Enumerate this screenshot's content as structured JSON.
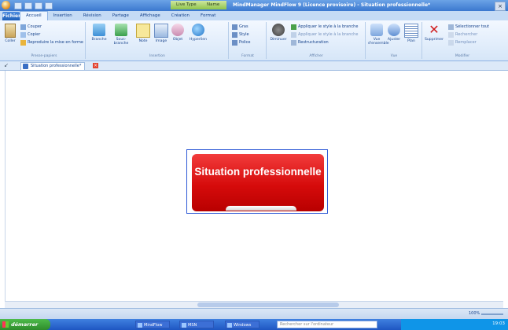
{
  "window": {
    "title": "MindManager MindFlow 9 (Licence provisoire) - Situation professionnelle*",
    "contextual_tabs": [
      "Live Type",
      "Name"
    ],
    "close_symbol": "×"
  },
  "ribbon": {
    "file_tab": "Fichier",
    "tabs": [
      "Accueil",
      "Insertion",
      "Révision",
      "Partage",
      "Affichage",
      "Création",
      "Format"
    ],
    "active_tab": "Accueil",
    "groups": {
      "clipboard": {
        "label": "Presse-papiers",
        "items": [
          "Couper",
          "Copier",
          "Reproduire la mise en forme"
        ],
        "paste": "Coller"
      },
      "insert": {
        "label": "Insertion",
        "items": [
          "Branche",
          "Sous-branche",
          "Note",
          "Image",
          "Objet",
          "Hyperlien"
        ]
      },
      "format": {
        "label": "Format",
        "items": [
          "Gras",
          "Style",
          "Police"
        ]
      },
      "focus": {
        "label": "Afficher",
        "big": "Diminuer",
        "items": [
          "Appliquer le style à la branche",
          "Appliquer le style à la branche",
          "Restructuration"
        ]
      },
      "view": {
        "label": "Vue",
        "items": [
          "Vue d'ensemble",
          "Ajuster",
          "Plan"
        ]
      },
      "editing": {
        "label": "Modifier",
        "big": "Supprimer",
        "items": [
          "Sélectionner tout",
          "Rechercher",
          "Remplacer"
        ]
      }
    }
  },
  "document_tab": {
    "label": "Situation professionnelle*",
    "close_symbol": "×"
  },
  "mindmap": {
    "central_topic": "Situation professionnelle",
    "topic_color": "#d60b0b"
  },
  "statusbar": {
    "zoom": "100%"
  },
  "taskbar": {
    "start_label": "démarrer",
    "items": [
      "MindFlow",
      "MSN",
      "Windows"
    ],
    "search_placeholder": "Rechercher sur l'ordinateur",
    "clock": "19:03"
  },
  "colors": {
    "titlebar": "#3b78cf",
    "ribbon": "#d6e6f8",
    "accent": "#15428b",
    "topic": "#d60b0b",
    "taskbar": "#1f56c2"
  }
}
